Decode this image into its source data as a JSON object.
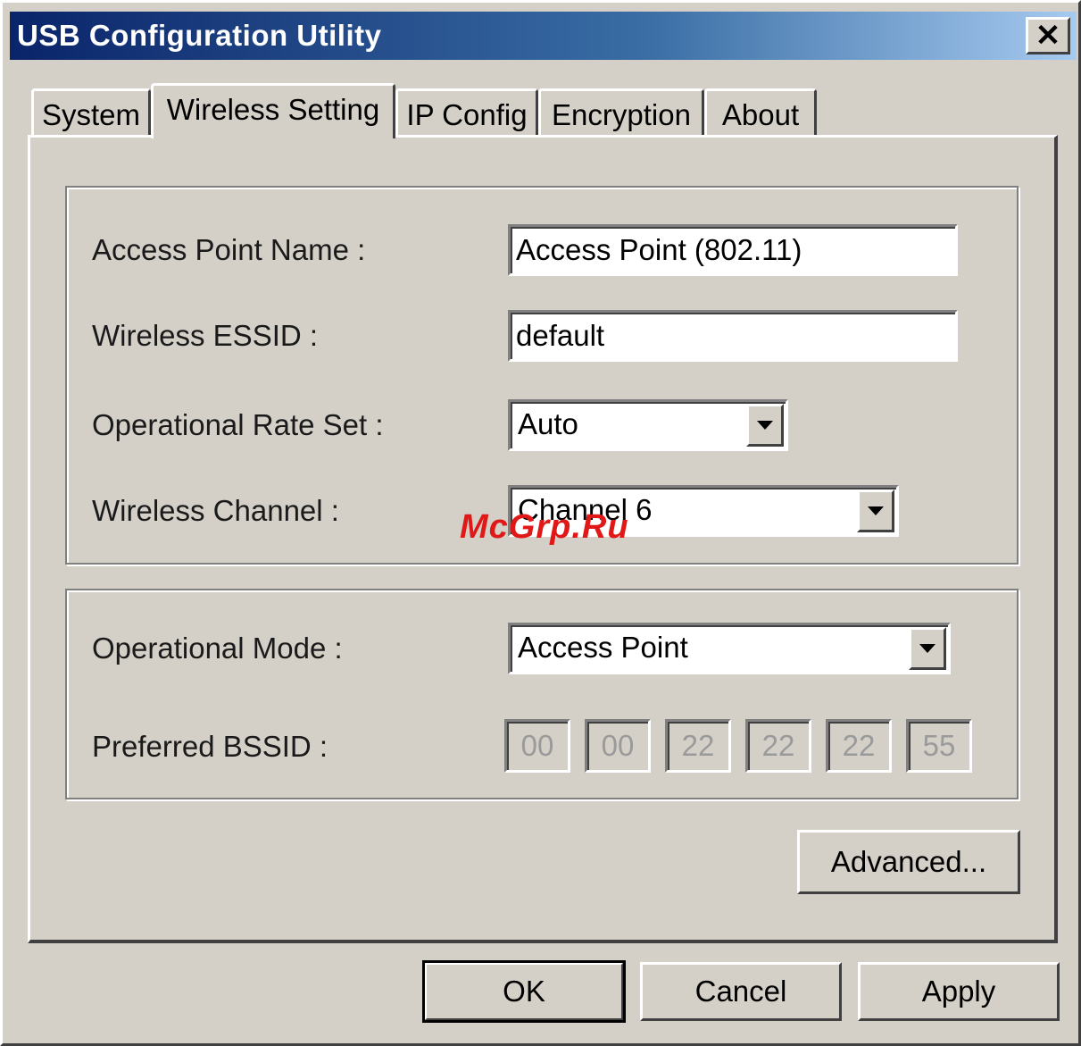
{
  "window": {
    "title": "USB Configuration Utility"
  },
  "tabs": [
    {
      "label": "System"
    },
    {
      "label": "Wireless Setting"
    },
    {
      "label": "IP Config"
    },
    {
      "label": "Encryption"
    },
    {
      "label": "About"
    }
  ],
  "active_tab": "Wireless Setting",
  "form": {
    "ap_name_label": "Access Point Name :",
    "ap_name_value": "Access Point (802.11)",
    "essid_label": "Wireless ESSID :",
    "essid_value": "default",
    "rate_label": "Operational Rate Set :",
    "rate_value": "Auto",
    "channel_label": "Wireless Channel :",
    "channel_value": "Channel 6",
    "mode_label": "Operational Mode :",
    "mode_value": "Access Point",
    "bssid_label": "Preferred BSSID :",
    "bssid": [
      "00",
      "00",
      "22",
      "22",
      "22",
      "55"
    ]
  },
  "buttons": {
    "advanced": "Advanced...",
    "ok": "OK",
    "cancel": "Cancel",
    "apply": "Apply"
  },
  "watermark": "McGrp.Ru",
  "colors": {
    "titlebar_start": "#0a246a",
    "titlebar_end": "#a6caf0",
    "face": "#d4d0c8",
    "watermark": "#e01818"
  }
}
